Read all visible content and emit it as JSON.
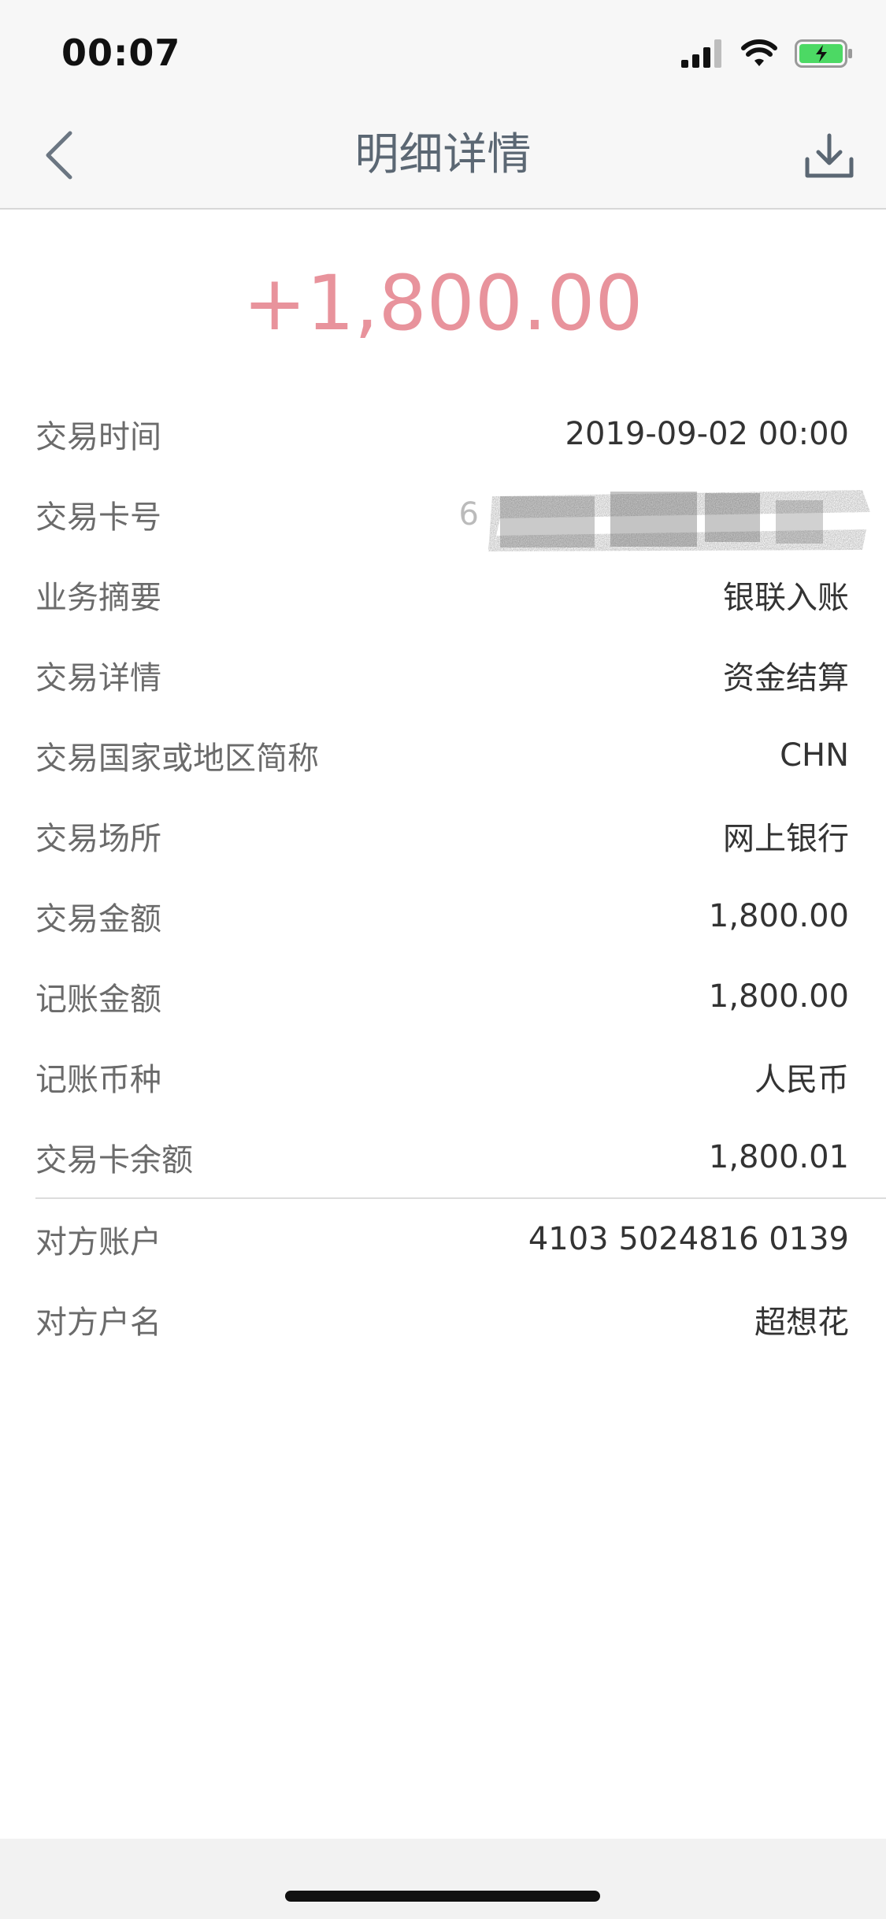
{
  "status": {
    "time": "00:07"
  },
  "nav": {
    "title": "明细详情"
  },
  "amount": "+1,800.00",
  "details": [
    {
      "label": "交易时间",
      "value": "2019-09-02 00:00"
    },
    {
      "label": "交易卡号",
      "value": "6"
    },
    {
      "label": "业务摘要",
      "value": "银联入账"
    },
    {
      "label": "交易详情",
      "value": "资金结算"
    },
    {
      "label": "交易国家或地区简称",
      "value": "CHN"
    },
    {
      "label": "交易场所",
      "value": "网上银行"
    },
    {
      "label": "交易金额",
      "value": "1,800.00"
    },
    {
      "label": "记账金额",
      "value": "1,800.00"
    },
    {
      "label": "记账币种",
      "value": "人民币"
    },
    {
      "label": "交易卡余额",
      "value": "1,800.01"
    },
    {
      "label": "对方账户",
      "value": "4103 5024816 0139"
    },
    {
      "label": "对方户名",
      "value": "超想花"
    }
  ],
  "colors": {
    "amount": "#e8939c",
    "title": "#5b6773",
    "battery": "#4cd964"
  },
  "icons": {
    "back": "chevron-left-icon",
    "download": "download-icon",
    "signal": "signal-icon",
    "wifi": "wifi-icon",
    "battery": "battery-charging-icon"
  }
}
